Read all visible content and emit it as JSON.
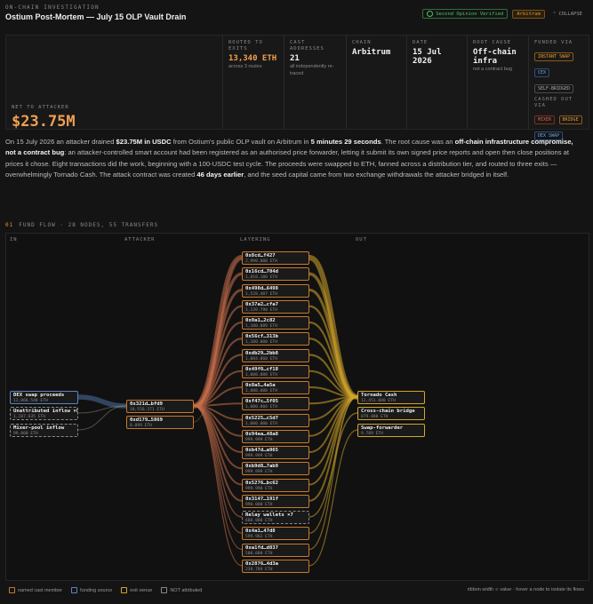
{
  "header": {
    "kicker": "ON-CHAIN INVESTIGATION",
    "title": "Ostium Post-Mortem — July 15 OLP Vault Drain",
    "verified_label": "Second Opinion Verified",
    "chain_pill": "Arbitrum",
    "collapse_label": "COLLAPSE"
  },
  "summary": {
    "net_label": "NET TO ATTACKER",
    "net_value": "$23.75M",
    "routed_label": "ROUTED TO EXITS",
    "routed_value": "13,340 ETH",
    "routed_sub": "across 3 routes",
    "cast_label": "CAST ADDRESSES",
    "cast_value": "21",
    "cast_sub": "all independently re-traced",
    "chain_label": "CHAIN",
    "chain_value": "Arbitrum",
    "date_label": "DATE",
    "date_value": "15 Jul 2026",
    "root_label": "ROOT CAUSE",
    "root_value": "Off-chain infra",
    "root_sub": "not a contract bug",
    "funded_label": "FUNDED VIA",
    "funded_tags": [
      "INSTANT SWAP",
      "CEX",
      "SELF-BRIDGED"
    ],
    "cashed_label": "CASHED OUT VIA",
    "cashed_tags": [
      "MIXER",
      "BRIDGE",
      "DEX SWAP"
    ]
  },
  "narrative": {
    "p1": "On 15 July 2026 an attacker drained ",
    "b1": "$23.75M in USDC",
    "p2": " from Ostium's public OLP vault on Arbitrum in ",
    "b2": "5 minutes 29 seconds",
    "p3": ". The root cause was an ",
    "b3": "off-chain infrastructure compromise, not a contract bug",
    "p4": ": an attacker-controlled smart account had been registered as an authorised price forwarder, letting it submit its own signed price reports and open then close positions at prices it chose. Eight transactions did the work, beginning with a 100-USDC test cycle. The proceeds were swapped to ETH, fanned across a distribution tier, and routed to three exits — overwhelmingly Tornado Cash. The attack contract was created ",
    "b4": "46 days earlier",
    "p5": ", and the seed capital came from two exchange withdrawals the attacker bridged in itself."
  },
  "flow": {
    "section_num": "01",
    "section_title": "FUND FLOW · 28 NODES, 55 TRANSFERS",
    "col_in": "IN",
    "col_attacker": "ATTACKER",
    "col_layering": "LAYERING",
    "col_out": "OUT",
    "inputs": [
      {
        "name": "DEX swap proceeds",
        "value": "12,066.548 ETH",
        "style": "blue"
      },
      {
        "name": "Unattributed inflow ×8",
        "value": "1,187.635 ETH",
        "style": "dashed"
      },
      {
        "name": "Mixer-pool inflow",
        "value": "99.800 ETH",
        "style": "dashed"
      }
    ],
    "attackers": [
      {
        "name": "0x321d…bfd9",
        "value": "10,556.371 ETH"
      },
      {
        "name": "0xd179…5869",
        "value": "0.099 ETH"
      }
    ],
    "layers": [
      {
        "name": "0x8cd…f427",
        "value": "2,990.000 ETH",
        "style": "orange"
      },
      {
        "name": "0x16cd…704d",
        "value": "1,810.100 ETH",
        "style": "orange"
      },
      {
        "name": "0x498d…6498",
        "value": "1,528.407 ETH",
        "style": "orange"
      },
      {
        "name": "0x37a2…cfa7",
        "value": "1,139.790 ETH",
        "style": "orange"
      },
      {
        "name": "0x0a1…2c82",
        "value": "1,100.089 ETH",
        "style": "orange"
      },
      {
        "name": "0x56cf…313b",
        "value": "1,100.000 ETH",
        "style": "orange"
      },
      {
        "name": "0xdb29…2bb8",
        "value": "1,084.860 ETH",
        "style": "orange"
      },
      {
        "name": "0x49f0…cf18",
        "value": "1,000.088 ETH",
        "style": "orange"
      },
      {
        "name": "0x8a5…4a5a",
        "value": "1,000.088 ETH",
        "style": "orange"
      },
      {
        "name": "0xf47c…5f05",
        "value": "1,000.004 ETH",
        "style": "orange"
      },
      {
        "name": "0x5225…c5d7",
        "value": "1,000.000 ETH",
        "style": "orange"
      },
      {
        "name": "0x94ea…48a8",
        "value": "999.999 ETH",
        "style": "orange"
      },
      {
        "name": "0xb47d…a965",
        "value": "999.999 ETH",
        "style": "orange"
      },
      {
        "name": "0xb9d8…7ab9",
        "value": "999.999 ETH",
        "style": "orange"
      },
      {
        "name": "0x5276…bc62",
        "value": "999.990 ETH",
        "style": "orange"
      },
      {
        "name": "0x3147…191f",
        "value": "990.000 ETH",
        "style": "orange"
      },
      {
        "name": "Relay wallets ×7",
        "value": "688.880 ETH",
        "style": "dashed"
      },
      {
        "name": "0x4a1…47d8",
        "value": "599.902 ETH",
        "style": "orange"
      },
      {
        "name": "0xa1fd…d837",
        "value": "500.000 ETH",
        "style": "orange"
      },
      {
        "name": "0x2876…4d3a",
        "value": "239.789 ETH",
        "style": "orange"
      }
    ],
    "exits": [
      {
        "name": "Tornado Cash",
        "value": "12,451.000 ETH"
      },
      {
        "name": "Cross-chain bridge",
        "value": "879.880 ETH"
      },
      {
        "name": "Swap-forwarder",
        "value": "9.789 ETH"
      }
    ]
  },
  "legend": {
    "items": [
      {
        "label": "named cast member",
        "color": "#c8792a"
      },
      {
        "label": "funding source",
        "color": "#5a86c2"
      },
      {
        "label": "exit venue",
        "color": "#d4a52a"
      },
      {
        "label": "NOT attributed",
        "color": "#8a8a8a"
      }
    ],
    "note": "ribbon width ∝ value · hover a node to isolate its flows"
  },
  "colors": {
    "accent": "#e59a2a",
    "ribbon_orange": "#c8704a",
    "ribbon_gold": "#d4a52a",
    "ribbon_blue": "#5a86c2"
  }
}
